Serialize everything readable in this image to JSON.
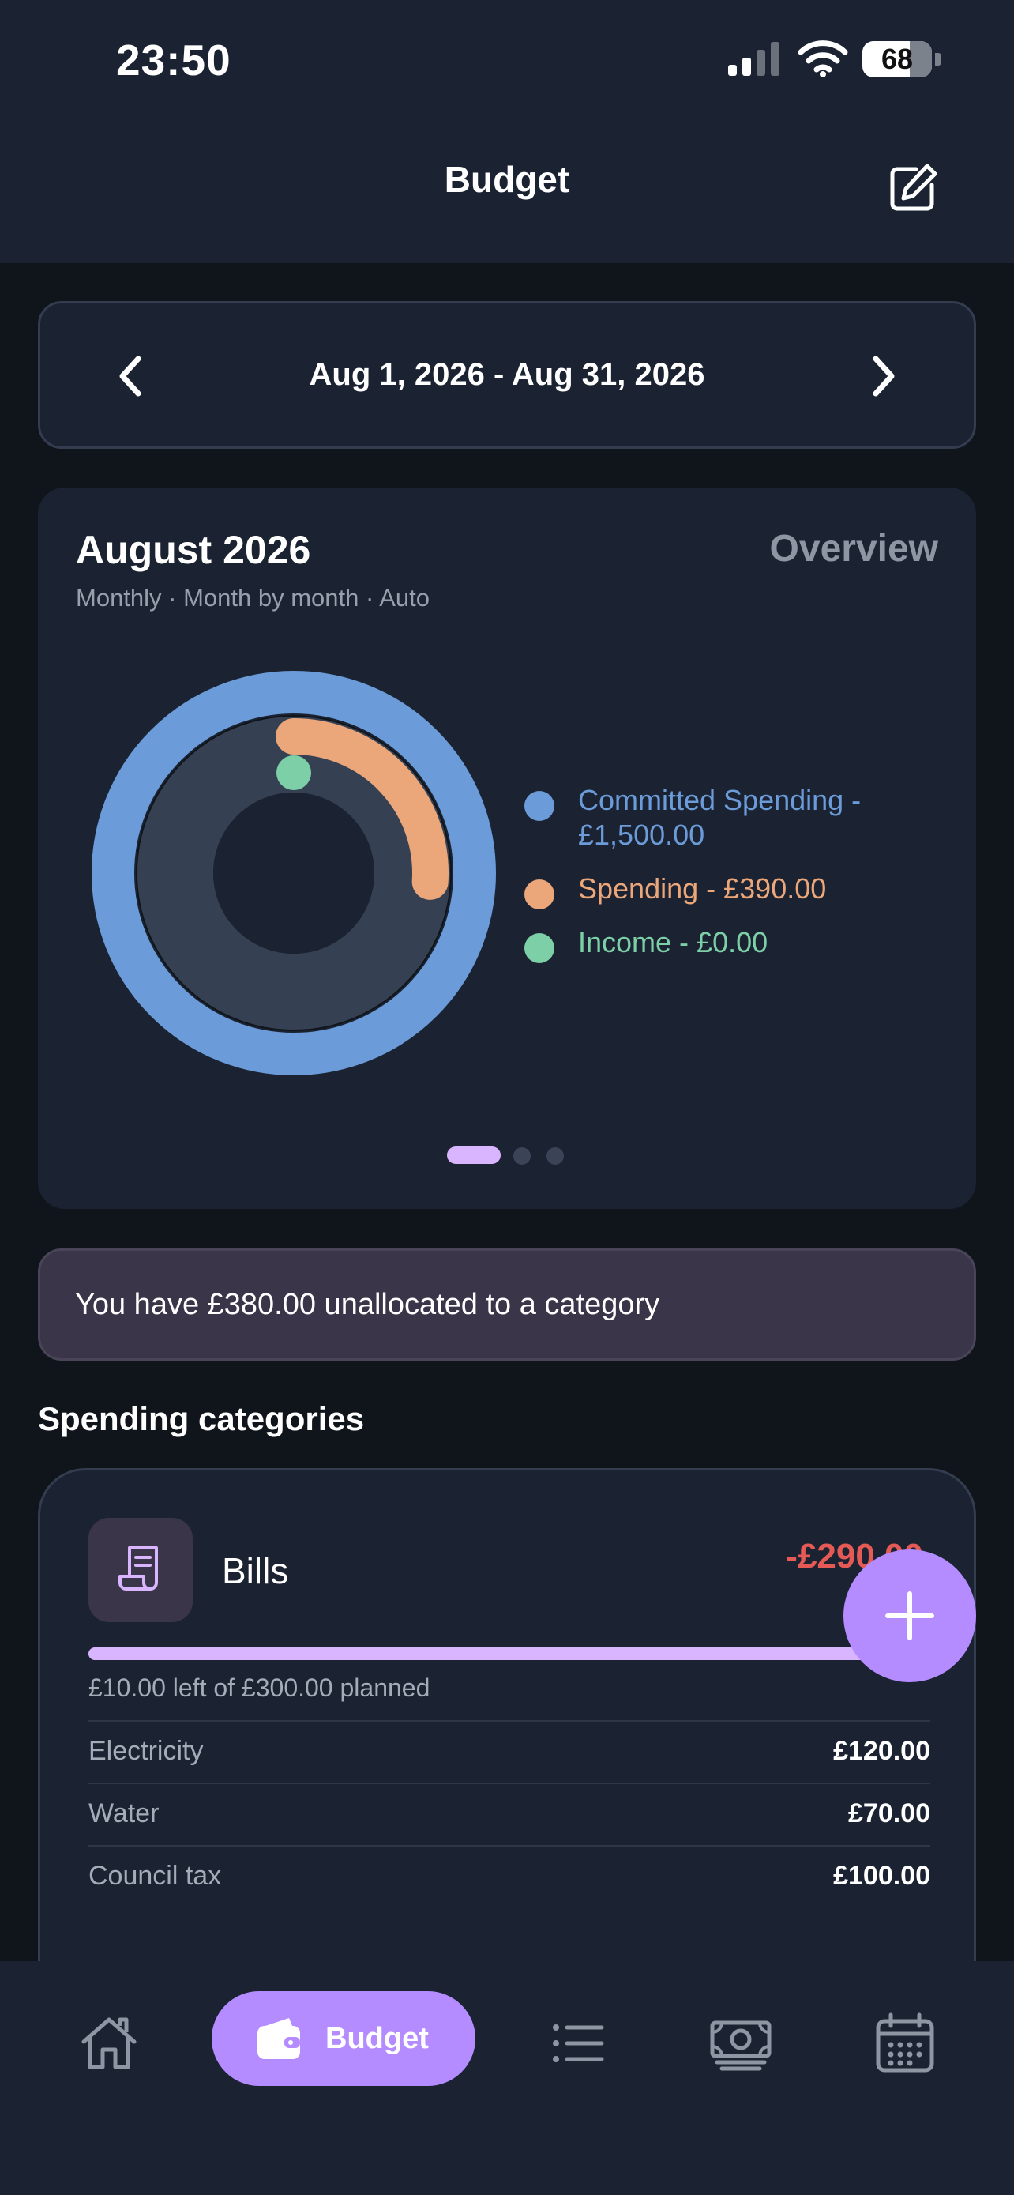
{
  "status_bar": {
    "time": "23:50",
    "battery": "68",
    "battery_level": 0.68
  },
  "header": {
    "title": "Budget",
    "edit_icon": "edit-icon"
  },
  "date_range": {
    "label": "Aug 1, 2026 - Aug 31, 2026"
  },
  "overview": {
    "title": "August 2026",
    "subtitle": "Monthly · Month by month · Auto",
    "link": "Overview",
    "legend": [
      {
        "label": "Committed Spending - £1,500.00",
        "color": "#6b9bd8"
      },
      {
        "label": "Spending - £390.00",
        "color": "#eba679"
      },
      {
        "label": "Income - £0.00",
        "color": "#7dcfa8"
      }
    ],
    "rings": {
      "committed_fraction": 1.0,
      "spending_fraction": 0.26,
      "income_fraction": 0.0
    },
    "pager": {
      "pages": 3,
      "active": 0
    }
  },
  "banner": {
    "text": "You have £380.00 unallocated to a category"
  },
  "section": {
    "title": "Spending categories"
  },
  "category": {
    "name": "Bills",
    "amount": "-£290.00",
    "progress": 0.97,
    "caption": "£10.00 left of £300.00 planned",
    "items": [
      {
        "label": "Electricity",
        "value": "£120.00"
      },
      {
        "label": "Water",
        "value": "£70.00"
      },
      {
        "label": "Council tax",
        "value": "£100.00"
      }
    ]
  },
  "nav": {
    "items": [
      "home-icon",
      "budget",
      "list-icon",
      "money-icon",
      "calendar-icon"
    ],
    "budget_label": "Budget"
  },
  "colors": {
    "accent": "#b48cff",
    "accent_light": "#d9b4ff",
    "negative": "#e65a55",
    "committed": "#6b9bd8",
    "spending": "#eba679",
    "income": "#7dcfa8"
  }
}
